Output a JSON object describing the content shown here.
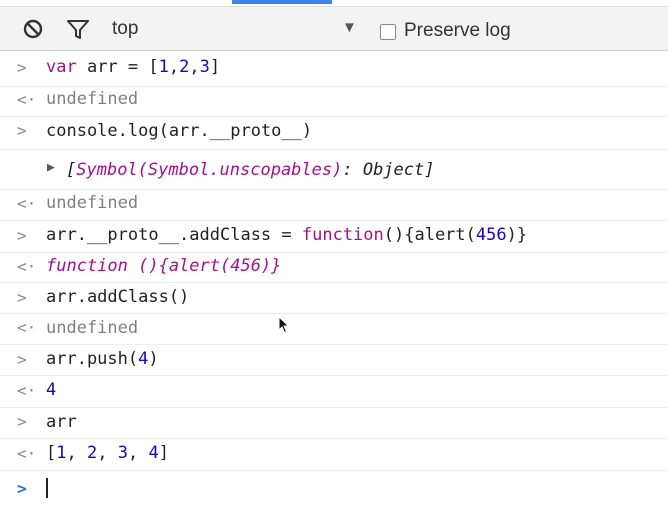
{
  "toolbar": {
    "context": "top",
    "preserve_log_label": "Preserve log",
    "icons": [
      "clear-console-icon",
      "filter-icon",
      "dropdown-arrow-icon"
    ]
  },
  "console": {
    "prompt_glyph": ">",
    "result_glyph": "<·",
    "expand_glyph": "▶",
    "l1": {
      "p1": "var",
      "p2": " arr = [",
      "n1": "1",
      "c1": ",",
      "n2": "2",
      "c2": ",",
      "n3": "3",
      "p3": "]"
    },
    "l2": "undefined",
    "l3": "console.log(arr.__proto__)",
    "l4": {
      "open": "[",
      "text": "Symbol(Symbol.unscopables)",
      "colon": ": Object",
      "close": "]"
    },
    "l5": "undefined",
    "l6": {
      "a": "arr.__proto__.addClass = ",
      "fn": "function",
      "b": "(){alert(",
      "n": "456",
      "c": ")}"
    },
    "l7": "function (){alert(456)}",
    "l8": "arr.addClass()",
    "l9": "undefined",
    "l10": {
      "a": "arr.push(",
      "n": "4",
      "b": ")"
    },
    "l11": "4",
    "l12": "arr",
    "l13": {
      "open": "[",
      "n1": "1",
      "s1": ", ",
      "n2": "2",
      "s2": ", ",
      "n3": "3",
      "s3": ", ",
      "n4": "4",
      "close": "]"
    },
    "input_value": ""
  },
  "colors": {
    "keyword": "#aa0d91",
    "number": "#1c00cf",
    "prompt_active": "#1a73e8",
    "tab_accent": "#3b83ee"
  }
}
